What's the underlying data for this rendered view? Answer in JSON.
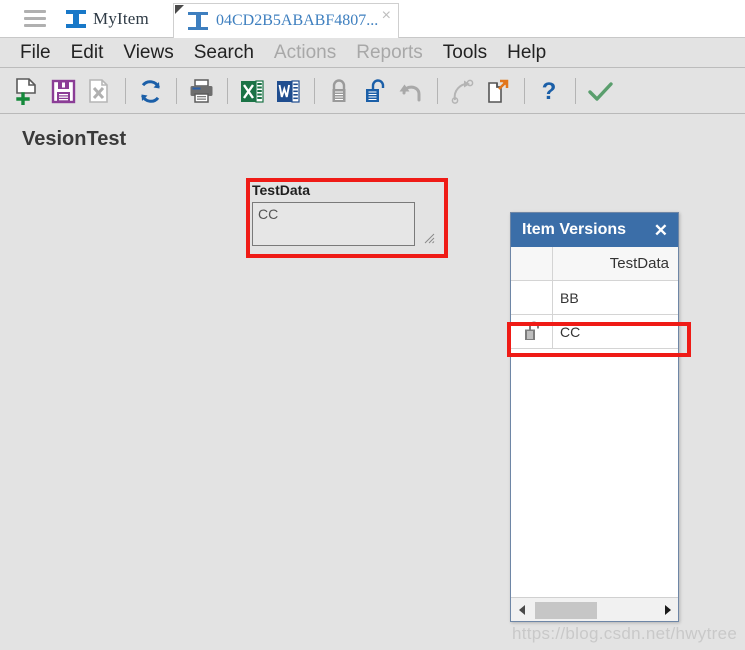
{
  "window": {
    "background_color": "#e3e3e3",
    "accent_color": "#3b6ea8"
  },
  "tabbar": {
    "menu_icon": "hamburger-icon",
    "brand_icon": "ibeam-icon",
    "brand_label": "MyItem",
    "document_tab": {
      "icon": "ibeam-outline-icon",
      "label": "04CD2B5ABABF4807...",
      "close_label": "×",
      "active": true
    }
  },
  "menubar": {
    "items": [
      {
        "label": "File",
        "disabled": false
      },
      {
        "label": "Edit",
        "disabled": false
      },
      {
        "label": "Views",
        "disabled": false
      },
      {
        "label": "Search",
        "disabled": false
      },
      {
        "label": "Actions",
        "disabled": true
      },
      {
        "label": "Reports",
        "disabled": true
      },
      {
        "label": "Tools",
        "disabled": false
      },
      {
        "label": "Help",
        "disabled": false
      }
    ]
  },
  "toolbar": {
    "buttons": [
      {
        "name": "new-item-icon",
        "title": "New",
        "disabled": false,
        "sep_after": false
      },
      {
        "name": "save-icon",
        "title": "Save",
        "disabled": false,
        "sep_after": false
      },
      {
        "name": "delete-icon",
        "title": "Delete",
        "disabled": true,
        "sep_after": true
      },
      {
        "name": "refresh-icon",
        "title": "Refresh",
        "disabled": false,
        "sep_after": true
      },
      {
        "name": "print-icon",
        "title": "Print",
        "disabled": false,
        "sep_after": true
      },
      {
        "name": "excel-export-icon",
        "title": "Excel",
        "disabled": false,
        "sep_after": false
      },
      {
        "name": "word-export-icon",
        "title": "Word",
        "disabled": false,
        "sep_after": true
      },
      {
        "name": "lock-icon",
        "title": "Lock",
        "disabled": true,
        "sep_after": false
      },
      {
        "name": "unlock-icon",
        "title": "Unlock",
        "disabled": false,
        "sep_after": false
      },
      {
        "name": "undo-icon",
        "title": "Undo",
        "disabled": true,
        "sep_after": true
      },
      {
        "name": "redo-icon",
        "title": "Redo",
        "disabled": true,
        "sep_after": false
      },
      {
        "name": "copy-page-icon",
        "title": "Copy",
        "disabled": false,
        "sep_after": true
      },
      {
        "name": "help-icon",
        "title": "Help",
        "disabled": false,
        "sep_after": true
      },
      {
        "name": "confirm-icon",
        "title": "Confirm",
        "disabled": false,
        "sep_after": false
      }
    ]
  },
  "content": {
    "page_title": "VesionTest",
    "form_field": {
      "label": "TestData",
      "value": "CC",
      "placeholder": ""
    }
  },
  "item_versions_panel": {
    "title": "Item Versions",
    "close_label": "✕",
    "columns": [
      "",
      "TestData"
    ],
    "rows": [
      {
        "icon": "",
        "value": "BB",
        "highlighted": false
      },
      {
        "icon": "lock-open-icon",
        "value": "CC",
        "highlighted": true
      }
    ],
    "scrollbar": {
      "left_arrow": "◀",
      "right_arrow": "▶"
    }
  },
  "annotations": {
    "highlight_color": "#ef1b16",
    "boxes": [
      "testdata-field",
      "version-row-cc"
    ]
  },
  "watermark": {
    "text": "https://blog.csdn.net/hwytree"
  }
}
